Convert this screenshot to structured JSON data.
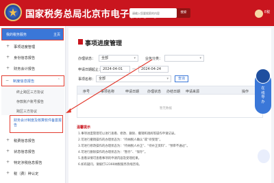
{
  "header": {
    "site_title": "国家税务总局北京市电子税务局",
    "search_placeholder": "请输入您要搜索的内容",
    "search_label": "搜索",
    "user_label": "E税"
  },
  "sidebar": {
    "top_label": "我的税务服务",
    "home_label": "主页",
    "items": [
      {
        "label": "事项进度管理"
      },
      {
        "label": "身份信息报告"
      },
      {
        "label": "财务会计报告"
      },
      {
        "label": "制度信息报告"
      },
      {
        "label": "税费信息报告"
      },
      {
        "label": "状态信息报告"
      },
      {
        "label": "特定涉税信息报告"
      },
      {
        "label": "税（费）种认定"
      }
    ],
    "sub_items": [
      {
        "label": "终止跨区三方协议"
      },
      {
        "label": "存款账户账号报告"
      },
      {
        "label": "跨区三方协议"
      }
    ],
    "selected_sub": "财务会计制度及核算软件备案报告"
  },
  "main": {
    "page_title": "事项进度管理",
    "status_label": "办理状态：",
    "status_value": "全部",
    "business_label": "业务分类：",
    "date_label": "申请日期起止：",
    "date_from": "2024-04-01",
    "date_sep": "—",
    "date_to": "2024-04-24",
    "item_label": "事项名称：",
    "item_value": "全部",
    "query_label": "查询",
    "columns": [
      "序号",
      "事项名称",
      "申请日期",
      "办理状态",
      "办结日期",
      "申请来源",
      "操作"
    ],
    "empty_text": "暂无数据",
    "notice_title": "温馨提示",
    "notice_lines": [
      "1.事项进度管理可以进行查看、修改、删除、撤销和调阅等操作申请记录。",
      "2.可进行撤销操作的办理状态为：“待纳税人确认”或“待受理”。",
      "3.可进行修改操作的办理状态为：“待纳税人补正”、“待补正资料”、“预审不通过”。",
      "4.可进行删除操作的办理状态为：“暂存”、“保存”。",
      "5.查看详情可查看事项的申请内容及受理结果。",
      "6.如有疑问，请拨打12366纳税服务热线咨询。"
    ]
  },
  "float": {
    "text": "在线导办"
  }
}
